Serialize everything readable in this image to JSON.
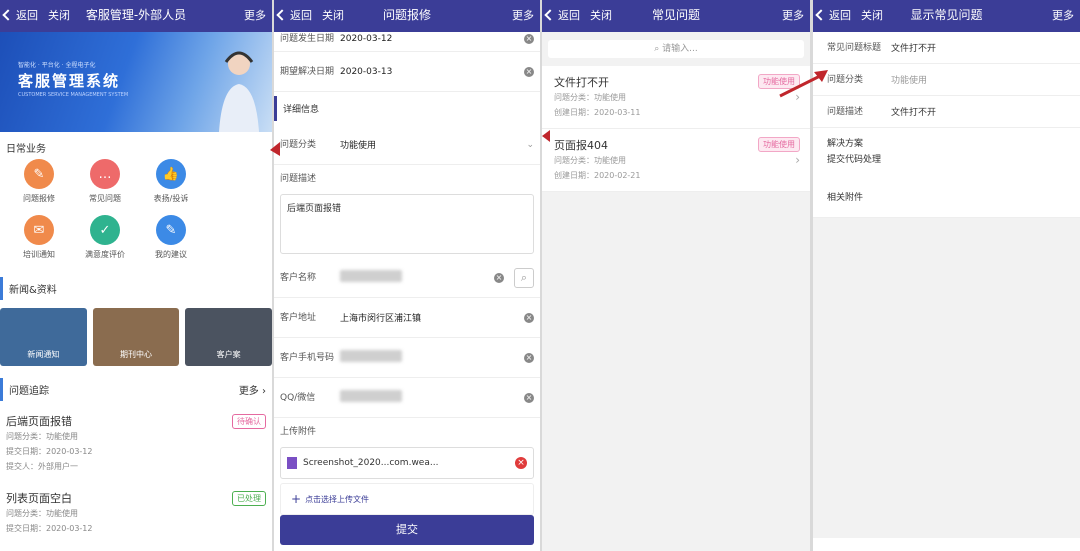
{
  "common": {
    "back": "返回",
    "close": "关闭",
    "more": "更多"
  },
  "s1": {
    "title": "客服管理-外部人员",
    "banner": {
      "small": "智能化 · 平台化 · 全程电子化",
      "big": "客服管理系统",
      "en": "CUSTOMER SERVICE MANAGEMENT SYSTEM"
    },
    "daily": "日常业务",
    "tiles": [
      {
        "label": "问题报修",
        "color": "#f08a4b",
        "glyph": "✎"
      },
      {
        "label": "常见问题",
        "color": "#ee6a6a",
        "glyph": "…"
      },
      {
        "label": "表扬/投诉",
        "color": "#3c8ae6",
        "glyph": "👍"
      },
      {
        "label": "培训通知",
        "color": "#f08a4b",
        "glyph": "✉"
      },
      {
        "label": "满意度评价",
        "color": "#2fb38f",
        "glyph": "✓"
      },
      {
        "label": "我的建议",
        "color": "#3c8ae6",
        "glyph": "✎"
      }
    ],
    "news_title": "新闻&资料",
    "news": [
      {
        "label": "新闻通知",
        "bg": "#3f6a9a"
      },
      {
        "label": "期刊中心",
        "bg": "#8a6c4f"
      },
      {
        "label": "客户案",
        "bg": "#4b5360"
      }
    ],
    "track_title": "问题追踪",
    "track_more": "更多",
    "items": [
      {
        "title": "后端页面报错",
        "badge": "待确认",
        "badge_color": "#e56aa0",
        "l1": "问题分类：功能使用",
        "l2": "提交日期：2020-03-12",
        "l3": "提交人：外部用户一"
      },
      {
        "title": "列表页面空白",
        "badge": "已处理",
        "badge_color": "#4caf50",
        "l1": "问题分类：功能使用",
        "l2": "提交日期：2020-03-12",
        "l3": ""
      }
    ]
  },
  "s2": {
    "title": "问题报修",
    "occur_label": "问题发生日期",
    "occur": "2020-03-12",
    "expect_label": "期望解决日期",
    "expect": "2020-03-13",
    "detail": "详细信息",
    "cat_label": "问题分类",
    "cat": "功能使用",
    "desc_label": "问题描述",
    "desc": "后端页面报错",
    "cust_label": "客户名称",
    "addr_label": "客户地址",
    "addr": "上海市闵行区浦江镇",
    "phone_label": "客户手机号码",
    "qq_label": "QQ/微信",
    "attach_label": "上传附件",
    "attach_file": "Screenshot_2020...com.wea...",
    "upload": "点击选择上传文件",
    "submit": "提交"
  },
  "s3": {
    "title": "常见问题",
    "search": "请输入...",
    "faqs": [
      {
        "title": "文件打不开",
        "badge": "功能使用",
        "cat": "问题分类：功能使用",
        "date": "创建日期：2020-03-11"
      },
      {
        "title": "页面报404",
        "badge": "功能使用",
        "cat": "问题分类：功能使用",
        "date": "创建日期：2020-02-21"
      }
    ]
  },
  "s4": {
    "title": "显示常见问题",
    "rows": [
      {
        "label": "常见问题标题",
        "value": "文件打不开"
      },
      {
        "label": "问题分类",
        "value": "功能使用"
      },
      {
        "label": "问题描述",
        "value": "文件打不开"
      }
    ],
    "solution_label": "解决方案",
    "solution": "提交代码处理",
    "attach_label": "相关附件"
  }
}
